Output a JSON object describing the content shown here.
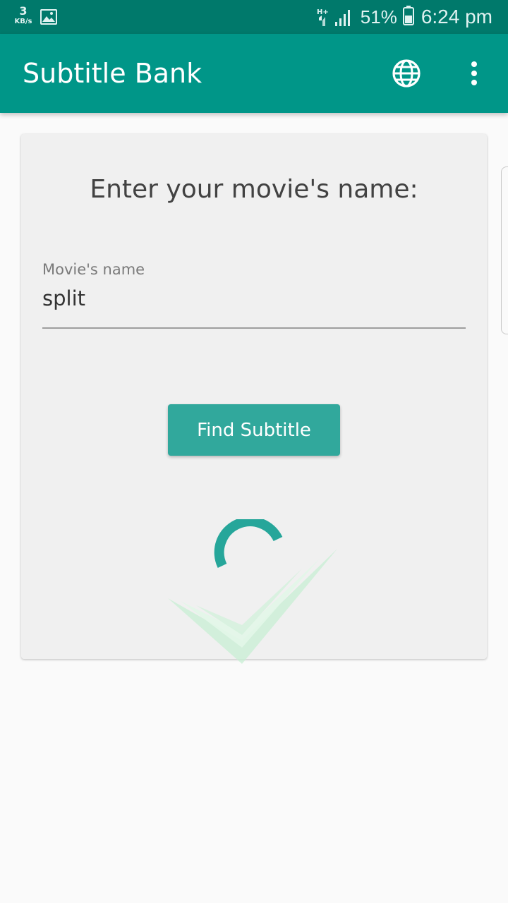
{
  "status_bar": {
    "net_speed_value": "3",
    "net_speed_unit": "KB/s",
    "network_type": "H+",
    "battery_percent": "51%",
    "time": "6:24 pm",
    "gallery_icon": "image-icon",
    "battery_icon": "battery-icon",
    "signal_icon": "signal-icon"
  },
  "app_bar": {
    "title": "Subtitle Bank",
    "language_icon": "globe-icon",
    "overflow_icon": "more-vert-icon",
    "color": "#009688"
  },
  "search_card": {
    "heading": "Enter your movie's name:",
    "field_label": "Movie's name",
    "field_value": "split",
    "button_label": "Find Subtitle",
    "button_color": "#31a89c",
    "loading": true,
    "spinner_color": "#26a69a"
  }
}
